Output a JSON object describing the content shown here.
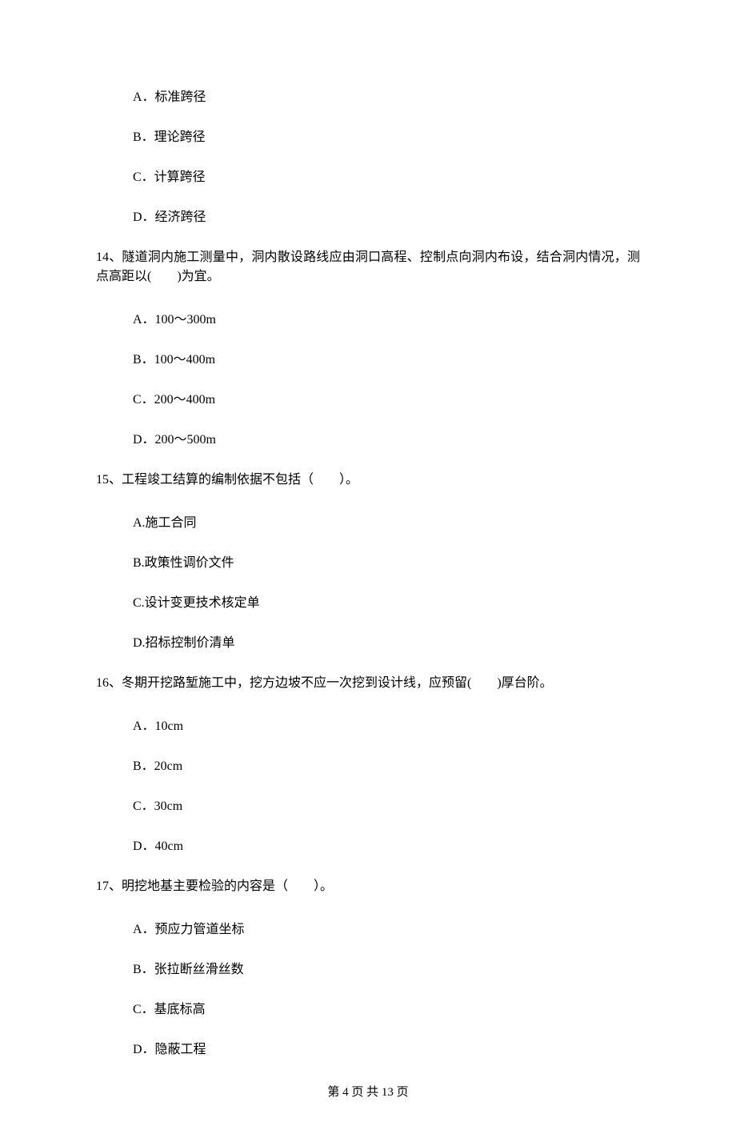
{
  "q13": {
    "optA": "A．标准跨径",
    "optB": "B．理论跨径",
    "optC": "C．计算跨径",
    "optD": "D．经济跨径"
  },
  "q14": {
    "stem": "14、隧道洞内施工测量中，洞内散设路线应由洞口高程、控制点向洞内布设，结合洞内情况，测点高距以(　　)为宜。",
    "optA": "A．100～300m",
    "optB": "B．100～400m",
    "optC": "C．200～400m",
    "optD": "D．200～500m"
  },
  "q15": {
    "stem": "15、工程竣工结算的编制依据不包括（　　）。",
    "optA": "A.施工合同",
    "optB": "B.政策性调价文件",
    "optC": "C.设计变更技术核定单",
    "optD": "D.招标控制价清单"
  },
  "q16": {
    "stem": "16、冬期开挖路堑施工中，挖方边坡不应一次挖到设计线，应预留(　　)厚台阶。",
    "optA": "A．10cm",
    "optB": "B．20cm",
    "optC": "C．30cm",
    "optD": "D．40cm"
  },
  "q17": {
    "stem": "17、明挖地基主要检验的内容是（　　）。",
    "optA": "A．预应力管道坐标",
    "optB": "B．张拉断丝滑丝数",
    "optC": "C．基底标高",
    "optD": "D．隐蔽工程"
  },
  "footer": "第 4 页 共 13 页"
}
